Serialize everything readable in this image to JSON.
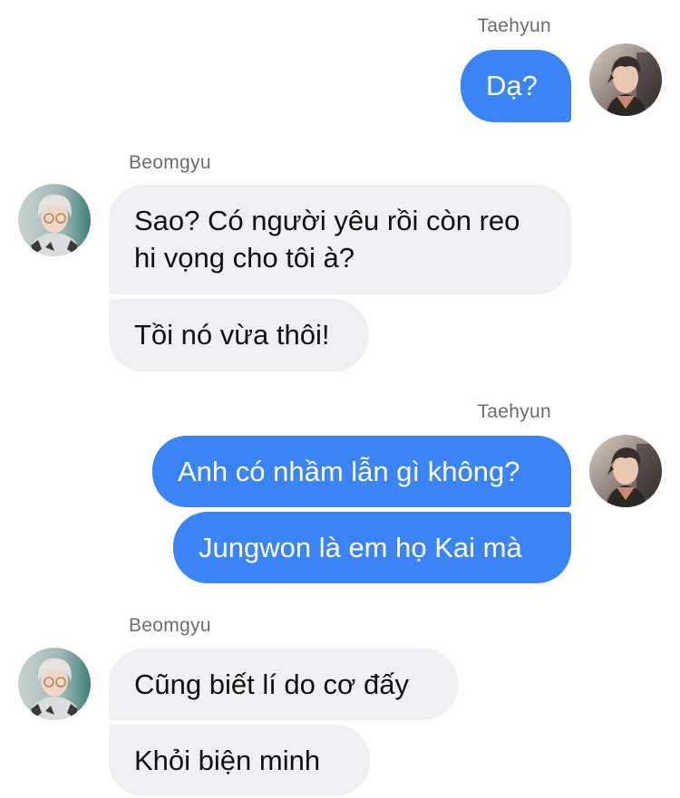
{
  "conversation": [
    {
      "sender": "Taehyun",
      "side": "right",
      "avatar_icon": "taehyun-avatar",
      "messages": [
        "Dạ?"
      ]
    },
    {
      "sender": "Beomgyu",
      "side": "left",
      "avatar_icon": "beomgyu-avatar",
      "messages": [
        "Sao? Có người yêu rồi còn reo\nhi vọng cho tôi à?",
        "Tồi nó vừa thôi!"
      ]
    },
    {
      "sender": "Taehyun",
      "side": "right",
      "avatar_icon": "taehyun-avatar",
      "messages": [
        "Anh có nhầm lẫn gì không?",
        "Jungwon là em họ Kai mà"
      ]
    },
    {
      "sender": "Beomgyu",
      "side": "left",
      "avatar_icon": "beomgyu-avatar",
      "messages": [
        "Cũng biết lí do cơ đấy",
        "Khỏi biện minh"
      ]
    }
  ],
  "colors": {
    "sent_bubble": "#3b84f5",
    "received_bubble": "#efeff4",
    "sender_name": "#6b6b70"
  }
}
